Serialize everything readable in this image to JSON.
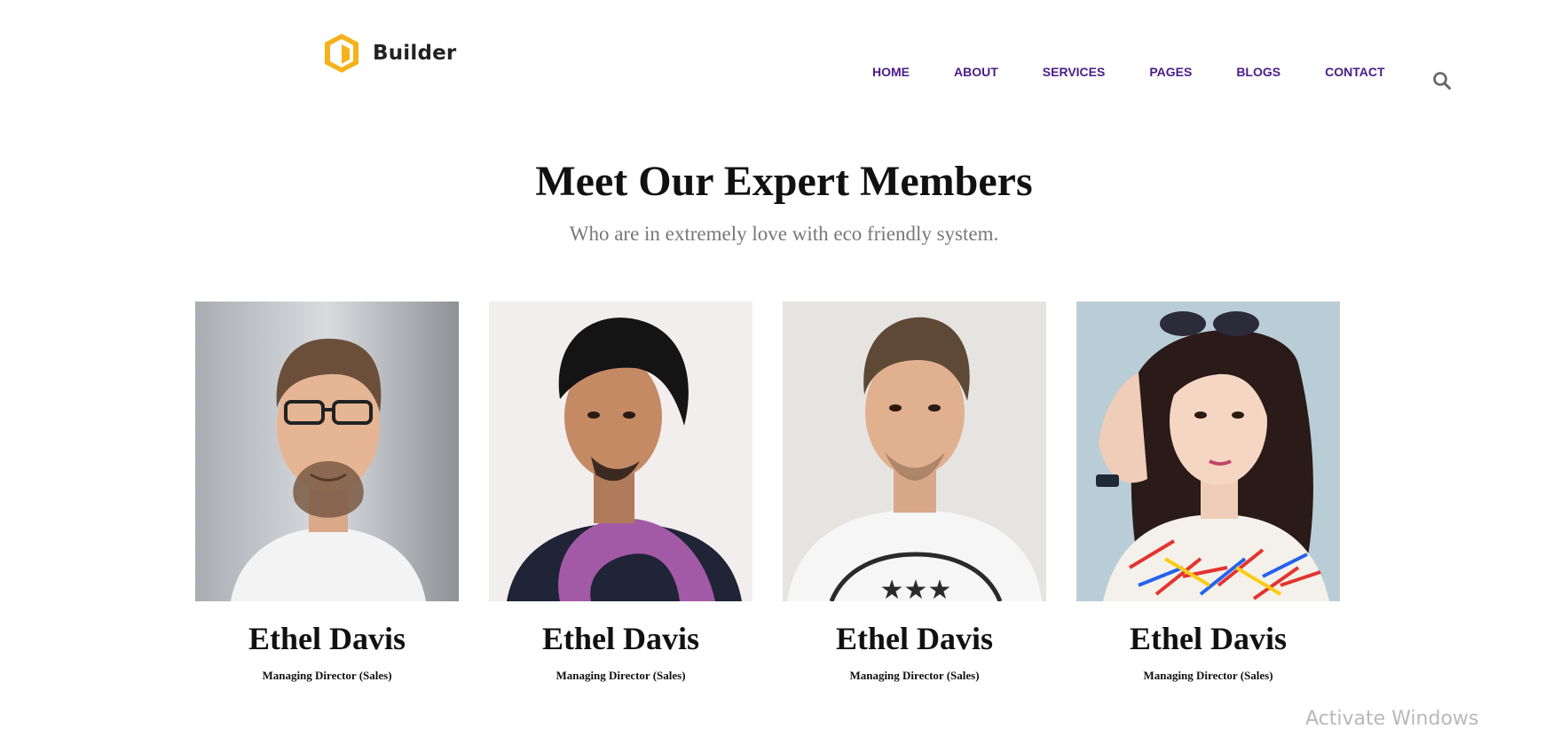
{
  "brand": {
    "name": "Builder",
    "accent": "#f5b21a"
  },
  "nav": {
    "items": [
      {
        "label": "HOME"
      },
      {
        "label": "ABOUT"
      },
      {
        "label": "SERVICES"
      },
      {
        "label": "PAGES"
      },
      {
        "label": "BLOGS"
      },
      {
        "label": "CONTACT"
      }
    ],
    "color": "#4b1c8a"
  },
  "section": {
    "title": "Meet Our Expert Members",
    "subtitle": "Who are in extremely love with eco friendly system."
  },
  "team": [
    {
      "name": "Ethel Davis",
      "role": "Managing Director (Sales)",
      "photo": "man-with-glasses-portrait"
    },
    {
      "name": "Ethel Davis",
      "role": "Managing Director (Sales)",
      "photo": "man-with-purple-scarf-portrait"
    },
    {
      "name": "Ethel Davis",
      "role": "Managing Director (Sales)",
      "photo": "man-in-white-tshirt-portrait"
    },
    {
      "name": "Ethel Davis",
      "role": "Managing Director (Sales)",
      "photo": "woman-with-sunglasses-portrait"
    }
  ],
  "overlay": {
    "watermark": "Activate Windows"
  }
}
